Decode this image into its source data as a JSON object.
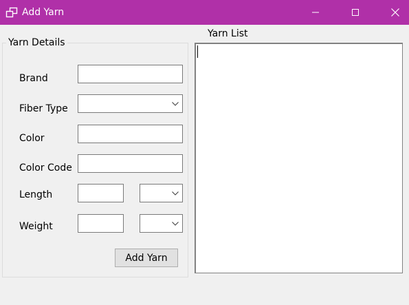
{
  "window": {
    "title": "Add Yarn",
    "app_icon": "window-restore-icon",
    "titlebar_color": "#b030a8"
  },
  "yarn_details": {
    "group_title": "Yarn Details",
    "brand_label": "Brand",
    "brand_value": "",
    "fiber_type_label": "Fiber Type",
    "fiber_type_value": "",
    "color_label": "Color",
    "color_value": "",
    "color_code_label": "Color Code",
    "color_code_value": "",
    "length_label": "Length",
    "length_value": "",
    "length_unit_value": "",
    "weight_label": "Weight",
    "weight_value": "",
    "weight_unit_value": "",
    "add_button_label": "Add Yarn"
  },
  "yarn_list": {
    "label": "Yarn List",
    "items": []
  }
}
